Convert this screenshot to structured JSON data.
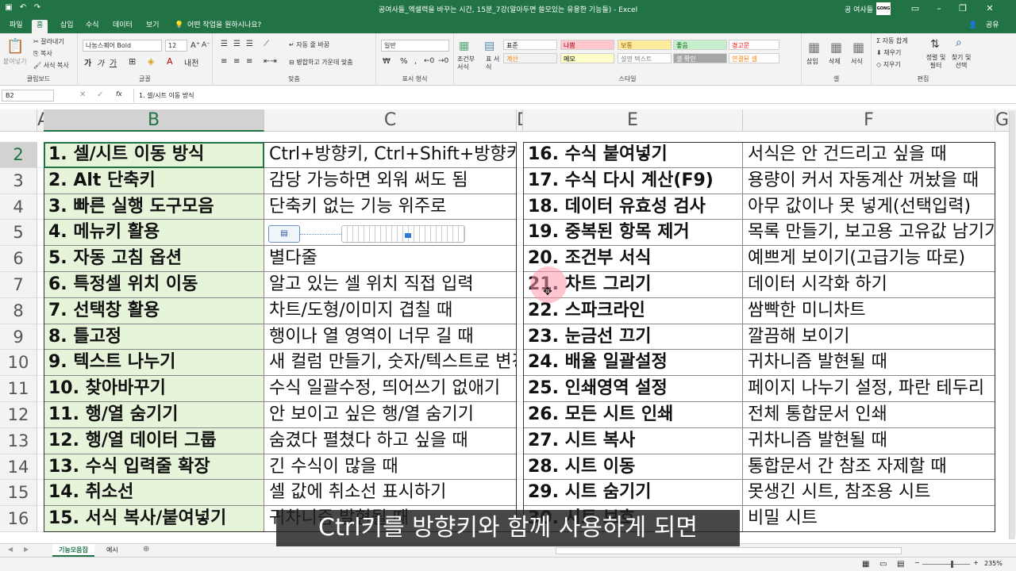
{
  "window": {
    "title": "공여사들_엑셀력을 바꾸는 시간, 15분_7강(알아두면 쓸모있는 유용한 기능들) - Excel",
    "user": "공 여사들",
    "logo_text": "GONG"
  },
  "tabs": [
    "파일",
    "홈",
    "삽입",
    "수식",
    "데이터",
    "보기"
  ],
  "tell_me": "어떤 작업을 원하시나요?",
  "share_label": "공유",
  "ribbon": {
    "clipboard": {
      "paste": "붙여넣기",
      "cut": "잘라내기",
      "copy": "복사",
      "format_painter": "서식 복사",
      "label": "클립보드"
    },
    "font": {
      "name": "나눔스퀘어 Bold",
      "size": "12",
      "label": "글꼴",
      "bold": "가",
      "italic": "가",
      "underline": "가"
    },
    "alignment": {
      "wrap": "자동 줄 바꿈",
      "merge": "병합하고 가운데 맞춤",
      "label": "맞춤"
    },
    "number": {
      "format": "일반",
      "label": "표시 형식"
    },
    "styles": {
      "conditional": "조건부 서식",
      "table": "표 서식",
      "items": [
        {
          "label": "표준",
          "bg": "#ffffff",
          "fg": "#000000"
        },
        {
          "label": "나쁨",
          "bg": "#ffc7ce",
          "fg": "#9c0006"
        },
        {
          "label": "보통",
          "bg": "#ffeb9c",
          "fg": "#9c5700"
        },
        {
          "label": "좋음",
          "bg": "#c6efce",
          "fg": "#006100"
        },
        {
          "label": "경고문",
          "bg": "#ffffff",
          "fg": "#ff0000"
        },
        {
          "label": "계산",
          "bg": "#f2f2f2",
          "fg": "#fa7d00"
        },
        {
          "label": "메모",
          "bg": "#ffffcc",
          "fg": "#000000"
        },
        {
          "label": "설명 텍스트",
          "bg": "#ffffff",
          "fg": "#7f7f7f"
        },
        {
          "label": "셀 확인",
          "bg": "#a5a5a5",
          "fg": "#ffffff"
        },
        {
          "label": "연결된 셀",
          "bg": "#ffffff",
          "fg": "#fa7d00"
        }
      ],
      "label": "스타일"
    },
    "cells": {
      "insert": "삽입",
      "delete": "삭제",
      "format": "서식",
      "label": "셀"
    },
    "editing": {
      "autosum": "자동 합계",
      "fill": "채우기",
      "clear": "지우기",
      "sort": "정렬 및 필터",
      "find": "찾기 및 선택",
      "label": "편집"
    }
  },
  "formula_bar": {
    "name_box": "B2",
    "fx": "fx",
    "content": "1. 셀/시트 이동 방식"
  },
  "columns": [
    "A",
    "B",
    "C",
    "D",
    "E",
    "F",
    "G"
  ],
  "rows": [
    {
      "num": "2",
      "b": "1. 셀/시트 이동 방식",
      "c": "Ctrl+방향키, Ctrl+Shift+방향키",
      "e": "16. 수식 붙여넣기",
      "f": "서식은 안 건드리고 싶을 때"
    },
    {
      "num": "3",
      "b": "2. Alt 단축키",
      "c": "감당 가능하면 외워 써도 됨",
      "e": "17. 수식 다시 계산(F9)",
      "f": "용량이 커서 자동계산 꺼놨을 때"
    },
    {
      "num": "4",
      "b": "3. 빠른 실행 도구모음",
      "c": "단축키 없는 기능 위주로",
      "e": "18. 데이터 유효성 검사",
      "f": "아무 값이나 못 넣게(선택입력)"
    },
    {
      "num": "5",
      "b": "4. 메뉴키 활용",
      "c": "",
      "e": "19. 중복된 항목 제거",
      "f": "목록 만들기, 보고용 고유값 남기기"
    },
    {
      "num": "6",
      "b": "5. 자동 고침 옵션",
      "c": "별다줄",
      "e": "20. 조건부 서식",
      "f": "예쁘게 보이기(고급기능 따로)"
    },
    {
      "num": "7",
      "b": "6. 특정셀 위치 이동",
      "c": "알고 있는 셀 위치 직접 입력",
      "e": "21. 차트 그리기",
      "f": "데이터 시각화 하기"
    },
    {
      "num": "8",
      "b": "7. 선택창 활용",
      "c": "차트/도형/이미지 겹칠 때",
      "e": "22. 스파크라인",
      "f": "쌈빡한 미니차트"
    },
    {
      "num": "9",
      "b": "8. 틀고정",
      "c": "행이나 열 영역이 너무 길 때",
      "e": "23. 눈금선 끄기",
      "f": "깔끔해 보이기"
    },
    {
      "num": "10",
      "b": "9. 텍스트 나누기",
      "c": "새 컬럼 만들기, 숫자/텍스트로 변경",
      "e": "24. 배율 일괄설정",
      "f": "귀차니즘 발현될 때"
    },
    {
      "num": "11",
      "b": "10. 찾아바꾸기",
      "c": "수식 일괄수정, 띄어쓰기 없애기",
      "e": "25. 인쇄영역 설정",
      "f": "페이지 나누기 설정, 파란 테두리"
    },
    {
      "num": "12",
      "b": "11. 행/열 숨기기",
      "c": "안 보이고 싶은 행/열 숨기기",
      "e": "26. 모든 시트 인쇄",
      "f": "전체 통합문서 인쇄"
    },
    {
      "num": "13",
      "b": "12. 행/열 데이터 그룹",
      "c": "숨겼다 펼쳤다 하고 싶을 때",
      "e": "27. 시트 복사",
      "f": "귀차니즘 발현될 때"
    },
    {
      "num": "14",
      "b": "13. 수식 입력줄 확장",
      "c": "긴 수식이 많을 때",
      "e": "28. 시트 이동",
      "f": "통합문서 간 참조 자제할 때"
    },
    {
      "num": "15",
      "b": "14. 취소선",
      "c": "셀 값에 취소선 표시하기",
      "e": "29. 시트 숨기기",
      "f": "못생긴 시트, 참조용 시트"
    },
    {
      "num": "16",
      "b": "15. 서식 복사/붙여넣기",
      "c": "귀차니즘 발현될 때",
      "e": "30. 시트 보호",
      "f": "비밀 시트"
    }
  ],
  "sheets": [
    "기능모음집",
    "예시"
  ],
  "zoom": "235%",
  "subtitle": "Ctrl키를 방향키와 함께 사용하게 되면",
  "colors": {
    "excel_green": "#217346",
    "selected_fill": "#e6f4d9"
  }
}
